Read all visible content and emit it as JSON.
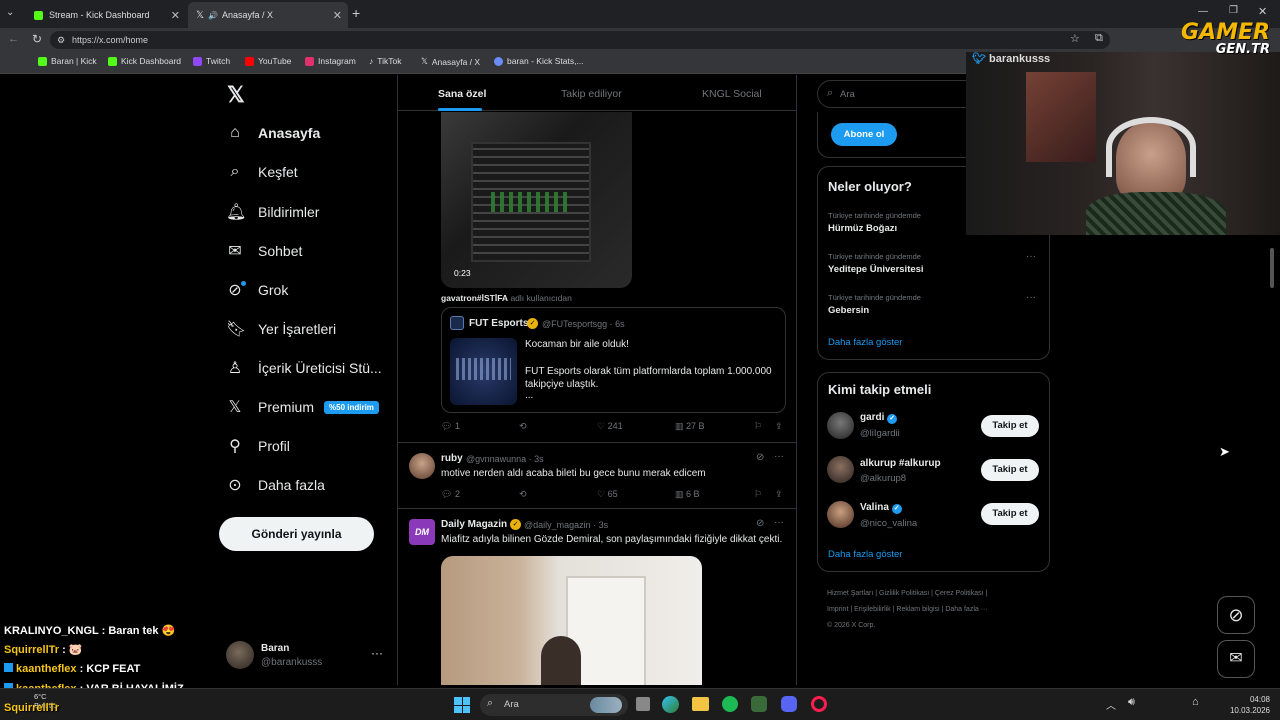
{
  "browser": {
    "tabs": [
      {
        "label": "Stream - Kick Dashboard"
      },
      {
        "label": "Anasayfa / X"
      }
    ],
    "url": "https://x.com/home",
    "bookmarks": [
      "Baran | Kick",
      "Kick Dashboard",
      "Twitch",
      "YouTube",
      "Instagram",
      "TikTok",
      "Anasayfa / X",
      "baran - Kick Stats,..."
    ]
  },
  "nav": {
    "items": [
      {
        "label": "Anasayfa",
        "icon": "home-icon"
      },
      {
        "label": "Keşfet",
        "icon": "search-icon"
      },
      {
        "label": "Bildirimler",
        "icon": "bell-icon"
      },
      {
        "label": "Sohbet",
        "icon": "mail-icon"
      },
      {
        "label": "Grok",
        "icon": "grok-icon"
      },
      {
        "label": "Yer İşaretleri",
        "icon": "bookmark-icon"
      },
      {
        "label": "İçerik Üreticisi Stü...",
        "icon": "creator-icon"
      },
      {
        "label": "Premium",
        "icon": "x-icon"
      },
      {
        "label": "Profil",
        "icon": "person-icon"
      },
      {
        "label": "Daha fazla",
        "icon": "more-circle-icon"
      }
    ],
    "premium_badge": "%50 indirim",
    "post_button": "Gönderi yayınla",
    "account": {
      "name": "Baran",
      "handle": "@barankusss"
    }
  },
  "timeline": {
    "tabs": [
      "Sana özel",
      "Takip ediliyor",
      "KNGL Social"
    ],
    "video_time": "0:23",
    "repost_note_user": "gavatron#İSTİFA",
    "repost_note_text": "adlı kullanıcıdan",
    "quoted": {
      "name": "FUT Esports",
      "handle": "@FUTesportsgg · 6s",
      "line1": "Kocaman bir aile olduk!",
      "line2": "FUT Esports olarak tüm platformlarda toplam 1.000.000 takipçiye ulaştık.",
      "line3": "..."
    },
    "post1_actions": {
      "replies": "1",
      "likes": "241",
      "views": "27 B"
    },
    "post2": {
      "name": "ruby",
      "handle": "@gvnnawunna · 3s",
      "text": "motive nerden aldı acaba bileti bu gece bunu merak edicem",
      "replies": "2",
      "likes": "65",
      "views": "6 B"
    },
    "post3": {
      "name": "Daily Magazin",
      "handle": "@daily_magazin · 3s",
      "text": "Miafitz adıyla bilinen Gözde Demiral, son paylaşımındaki fiziğiyle dikkat çekti.",
      "avatar_text": "DM"
    }
  },
  "right": {
    "search_placeholder": "Ara",
    "subscribe": "Abone ol",
    "trends_title": "Neler oluyor?",
    "trends": [
      {
        "category": "Türkiye tarihinde gündemde",
        "name": "Hürmüz Boğazı"
      },
      {
        "category": "Türkiye tarihinde gündemde",
        "name": "Yeditepe Üniversitesi"
      },
      {
        "category": "Türkiye tarihinde gündemde",
        "name": "Gebersin"
      }
    ],
    "show_more": "Daha fazla göster",
    "who_title": "Kimi takip etmeli",
    "who": [
      {
        "name": "gardi",
        "handle": "@liIgardii"
      },
      {
        "name": "alkurup #alkurup",
        "handle": "@alkurup8"
      },
      {
        "name": "Valina",
        "handle": "@nico_valina"
      }
    ],
    "follow_label": "Takip et",
    "footer": [
      "Hizmet Şartları",
      "Gizlilik Politikası",
      "Çerez Politikası",
      "Imprint",
      "Erişilebilirlik",
      "Reklam bilgisi",
      "Daha fazla ···",
      "© 2026 X Corp."
    ]
  },
  "stream": {
    "webcam_user": "barankusss",
    "logo_top": "GAMER",
    "logo_bottom": "GEN.TR"
  },
  "chat": [
    {
      "user": "KRALINYO_KNGL",
      "msg": "Baran tek 😍",
      "color": "#ffffff"
    },
    {
      "user": "SquirrellTr",
      "msg": "🐷",
      "color": "#f5c518"
    },
    {
      "user": "kaantheflex",
      "msg": "KCP FEAT",
      "color": "#f5c518"
    },
    {
      "user": "kaantheflex",
      "msg": "VAR Bİ HAYALİMİZ",
      "color": "#f5c518"
    },
    {
      "user": "SquirrellTr",
      "msg": "",
      "color": "#f5c518"
    }
  ],
  "taskbar": {
    "search": "Ara",
    "weather_temp": "6°C",
    "weather_text": "Bulutlu",
    "time": "04:08",
    "date": "10.03.2026"
  }
}
